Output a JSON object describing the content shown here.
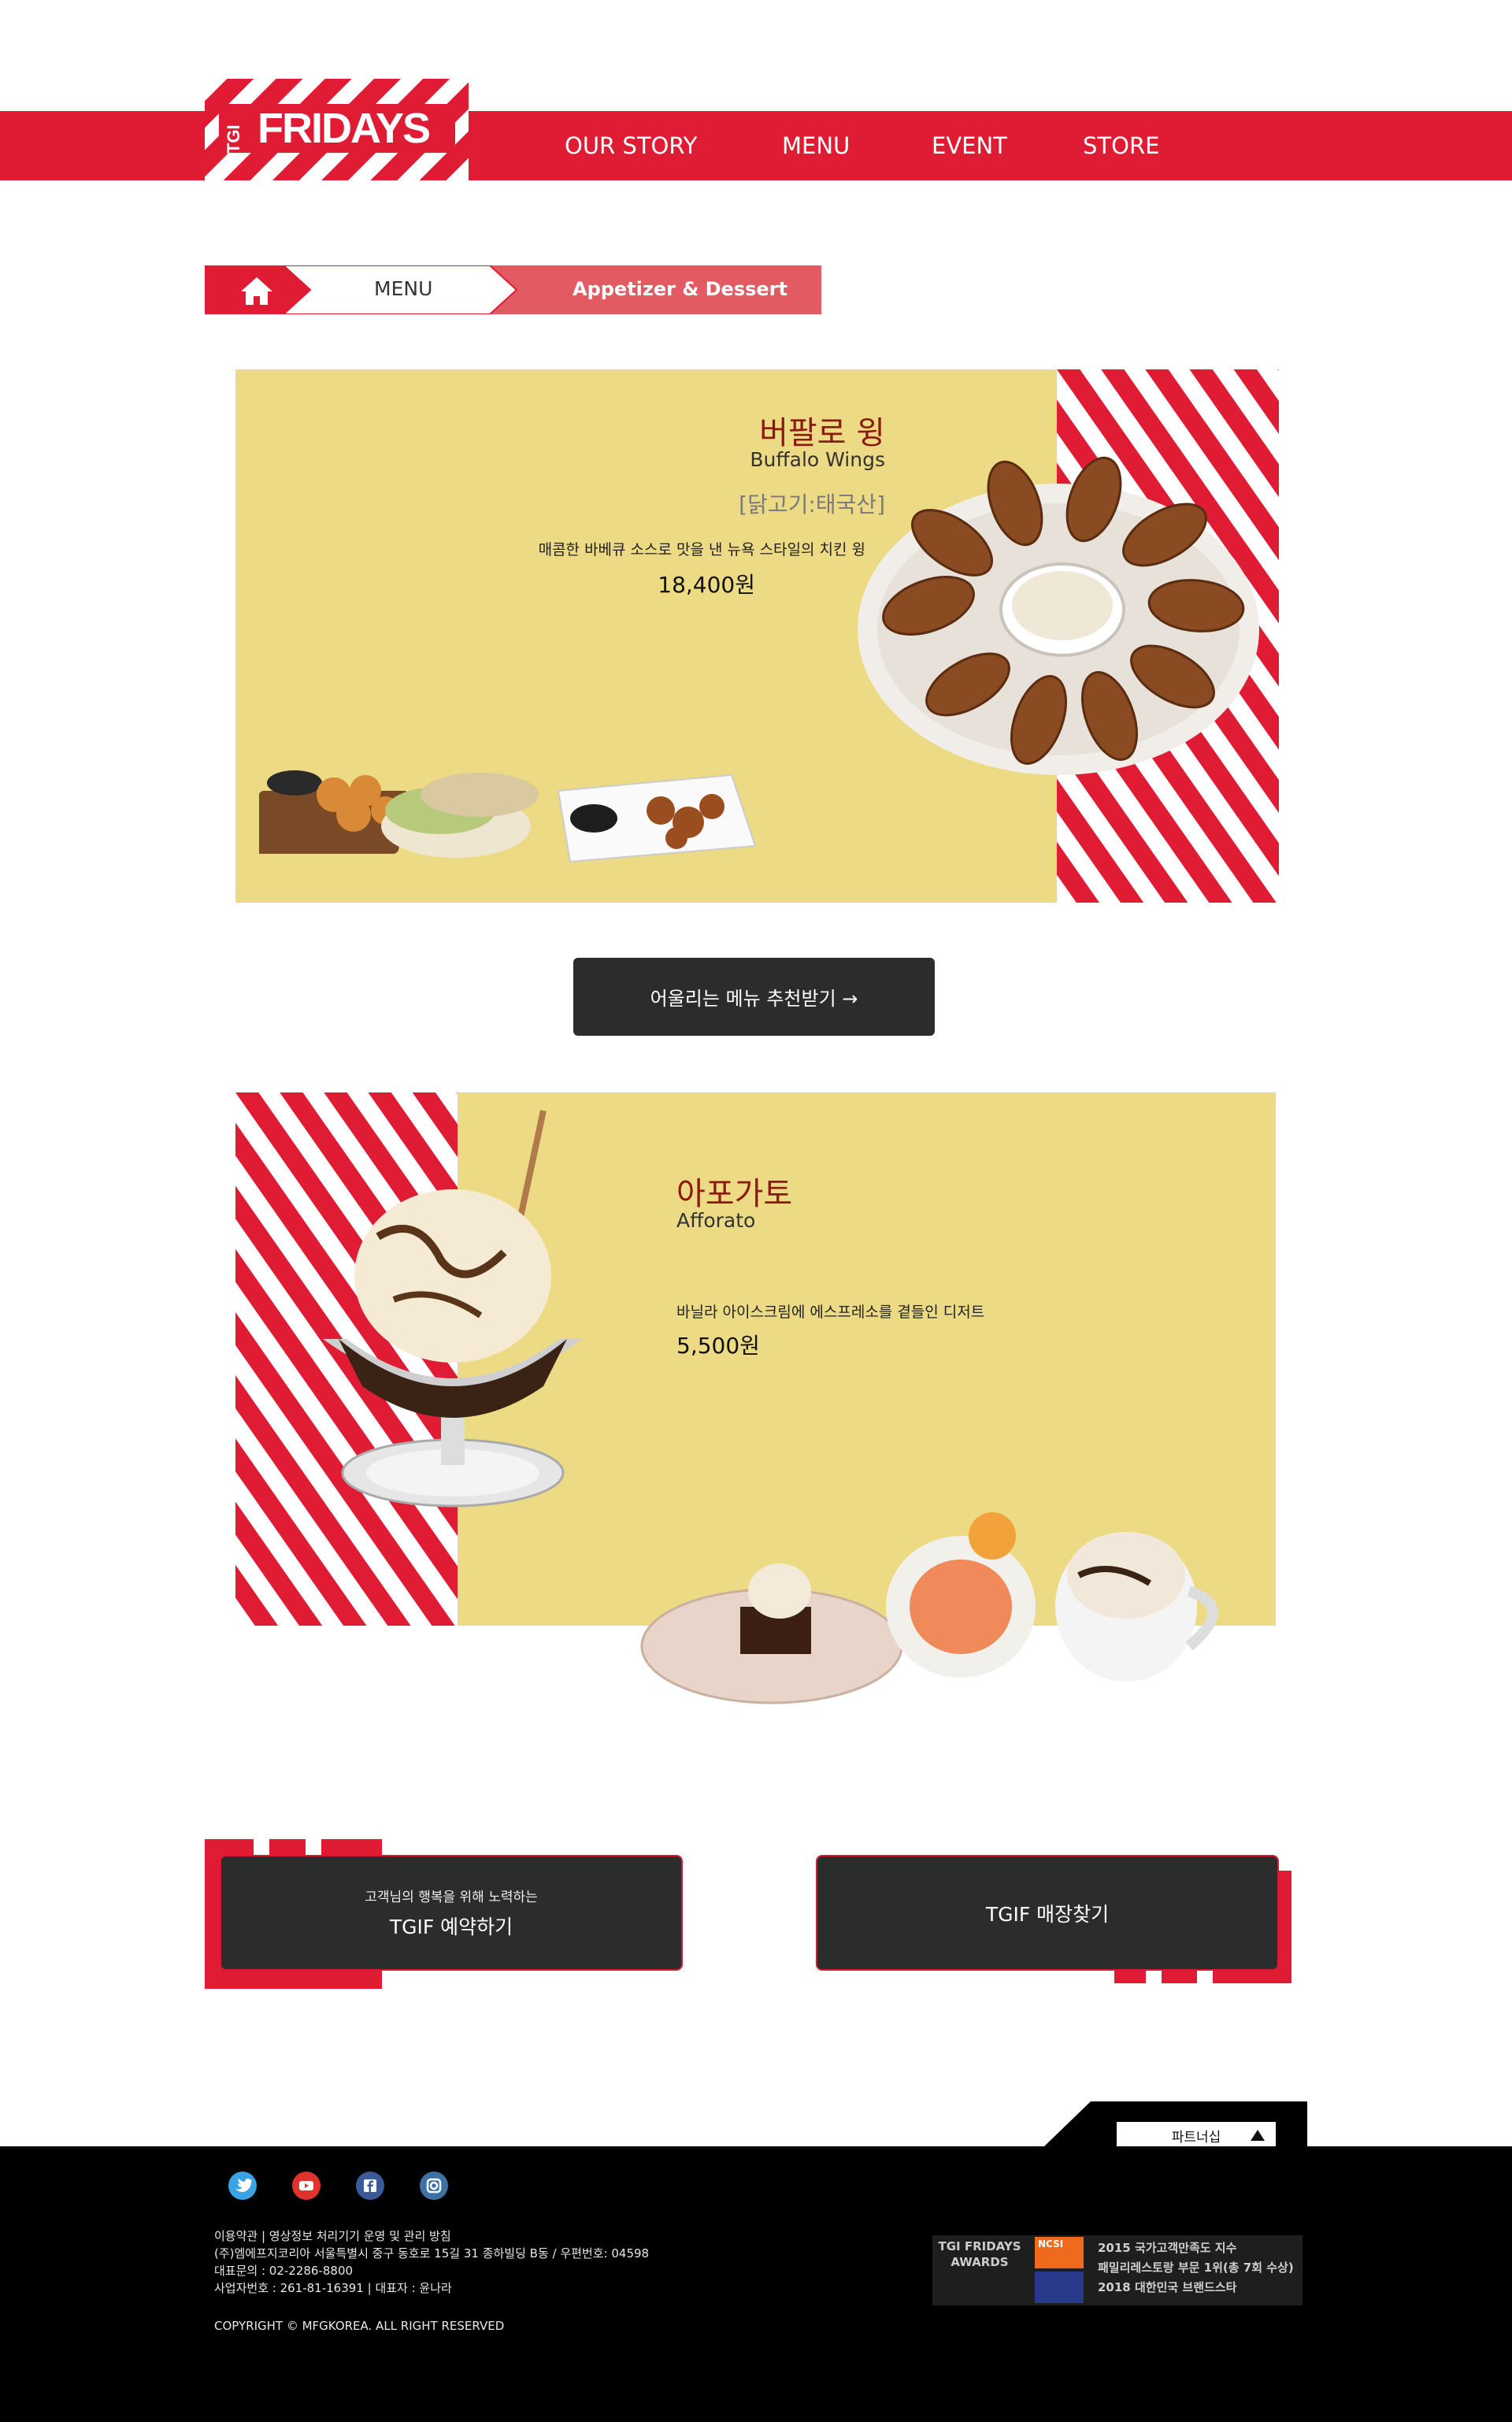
{
  "header": {
    "logo_text": "FRIDAYS",
    "logo_tgi": "TGI",
    "nav": [
      "OUR STORY",
      "MENU",
      "EVENT",
      "STORE"
    ]
  },
  "breadcrumb": {
    "home_icon": "home-icon",
    "level1": "MENU",
    "level2": "Appetizer & Dessert"
  },
  "items": [
    {
      "title_ko": "버팔로 윙",
      "title_en": "Buffalo Wings",
      "origin": "[닭고기:태국산]",
      "description": "매콤한 바베큐 소스로 맛을 낸 뉴욕 스타일의 치킨 윙",
      "price": "18,400원"
    },
    {
      "title_ko": "아포가토",
      "title_en": "Afforato",
      "description": "바닐라 아이스크림에 에스프레소를 곁들인 디저트",
      "price": "5,500원"
    }
  ],
  "recommend_button": "어울리는 메뉴 추천받기 →",
  "cta": {
    "reserve_sub": "고객님의 행복을 위해 노력하는",
    "reserve_label": "TGIF 예약하기",
    "store_label": "TGIF 매장찾기"
  },
  "footer": {
    "partnership": "파트너십",
    "social_icons": [
      "twitter-icon",
      "youtube-icon",
      "facebook-icon",
      "instagram-icon"
    ],
    "lines": [
      "이용약관 | 영상정보 처리기기 운영 및 관리 방침",
      "(주)엠에프지코리아 서울특별시 중구 동호로 15길 31 종하빌딩 B동 / 우편번호: 04598",
      "대표문의 : 02-2286-8800",
      "사업자번호 : 261-81-16391 | 대표자 : 윤나라"
    ],
    "copyright": "COPYRIGHT © MFGKOREA. ALL RIGHT RESERVED",
    "awards": {
      "heading1": "TGI FRIDAYS",
      "heading2": "AWARDS",
      "badge1": "NCSI",
      "line1": "2015 국가고객만족도 지수",
      "line2": "패밀리레스토랑 부문 1위(총 7회 수상)",
      "line3": "2018 대한민국 브랜드스타"
    }
  },
  "colors": {
    "brand_red": "#e01b34",
    "card_yellow": "#ecda84",
    "dark_button": "#2b2c2c"
  }
}
